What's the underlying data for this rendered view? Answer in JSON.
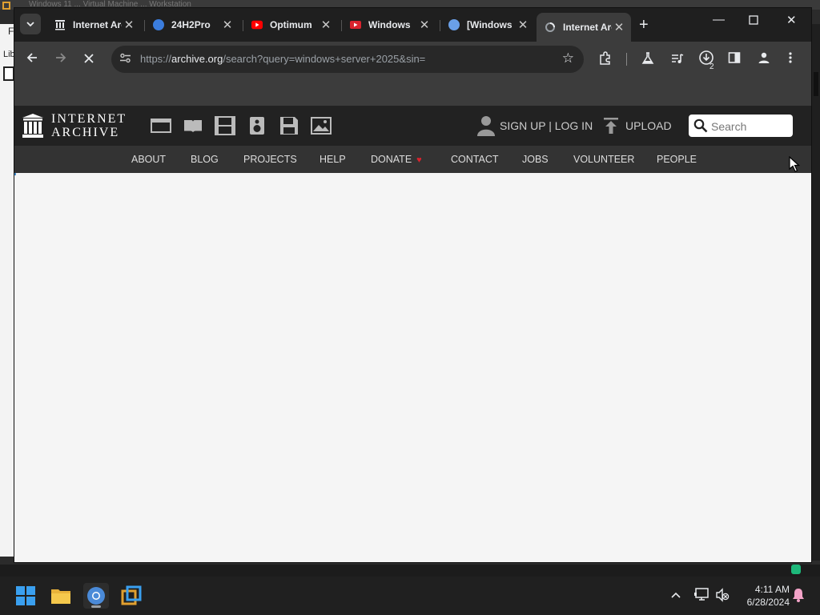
{
  "background_app": {
    "title": "Windows 11 ... Virtual Machine ... Workstation",
    "letter": "F",
    "lib_label": "Lib"
  },
  "browser": {
    "tabs": [
      {
        "title": "Internet Archive",
        "favicon": "archive-icon",
        "active": false
      },
      {
        "title": "24H2Pro",
        "favicon": "globe-icon",
        "active": false
      },
      {
        "title": "Optimum",
        "favicon": "youtube-icon",
        "active": false
      },
      {
        "title": "Windows",
        "favicon": "video-icon",
        "active": false
      },
      {
        "title": "[Windows",
        "favicon": "globe-icon",
        "active": false
      },
      {
        "title": "Internet Archive",
        "favicon": "loading-icon",
        "active": true
      }
    ],
    "url_domain": "archive.org",
    "url_prefix": "https://",
    "url_path": "/search?query=windows+server+2025&sin=",
    "download_count": "2"
  },
  "ia": {
    "logo_line1": "INTERNET",
    "logo_line2": "ARCHIVE",
    "signup_label": "SIGN UP | LOG IN",
    "upload_label": "UPLOAD",
    "search_placeholder": "Search",
    "nav": [
      "ABOUT",
      "BLOG",
      "PROJECTS",
      "HELP",
      "DONATE",
      "CONTACT",
      "JOBS",
      "VOLUNTEER",
      "PEOPLE"
    ]
  },
  "taskbar": {
    "time": "4:11 AM",
    "date": "6/28/2024"
  },
  "colors": {
    "ia_top": "#222222",
    "ia_nav": "#333333",
    "donate_heart": "#d9232e",
    "browser_toolbar": "#3c3c3c"
  }
}
